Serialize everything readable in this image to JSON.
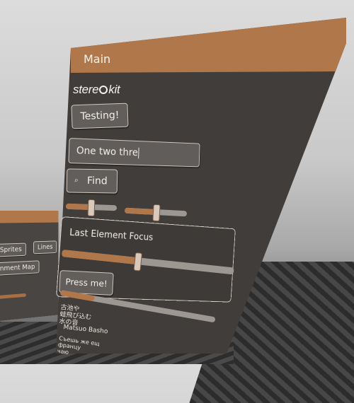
{
  "back_panel": {
    "buttons": [
      {
        "label": "Sprites"
      },
      {
        "label": "Lines"
      },
      {
        "label": "ronment Map"
      }
    ]
  },
  "main_panel": {
    "title": "Main",
    "logo": {
      "left": "stere",
      "right": "kit"
    },
    "testing_button": "Testing!",
    "text_input_value": "One two thre",
    "find_button": "Find",
    "sliders": [
      {
        "value": 0.48
      },
      {
        "value": 0.5
      }
    ],
    "group": {
      "title": "Last Element Focus",
      "slider_value": 0.44,
      "press_button": "Press me!",
      "progress_value": 0.22
    },
    "poem": {
      "lines": "古池や\n蛙飛び込む\n水の音",
      "author": "Matsuo Basho",
      "russian": "Съешь же ещ\nфранцу\nчаю"
    }
  },
  "colors": {
    "accent": "#b0774b",
    "panel": "#413d3a",
    "text": "#f3eee9"
  }
}
